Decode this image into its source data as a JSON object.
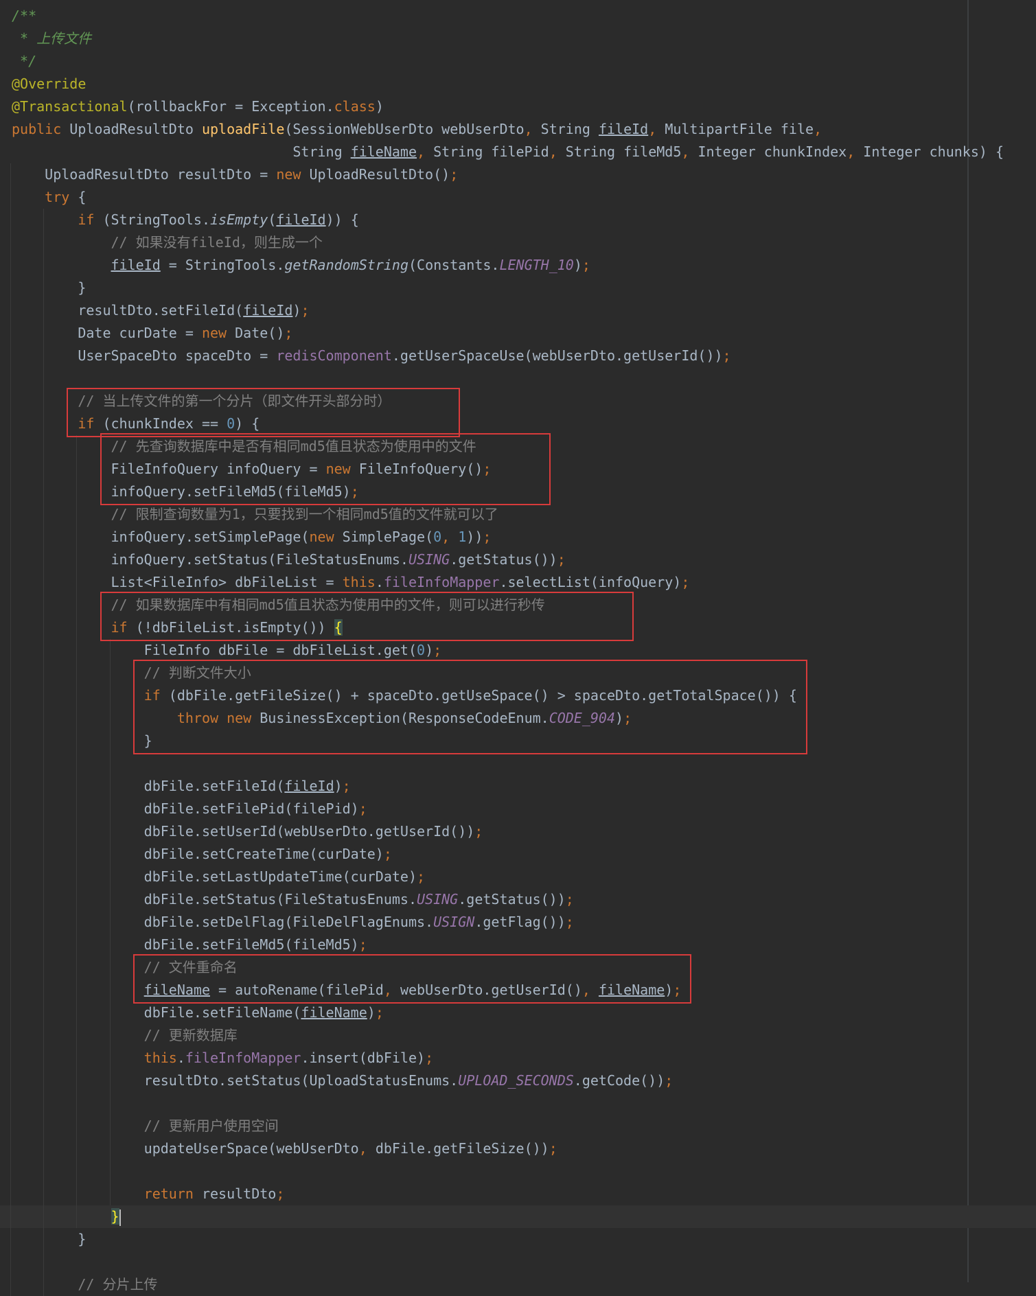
{
  "editor": {
    "lines": [
      [
        {
          "t": "/**",
          "c": "doc"
        }
      ],
      [
        {
          "t": " * ",
          "c": "doc"
        },
        {
          "t": "上传文件",
          "c": "doc"
        }
      ],
      [
        {
          "t": " */",
          "c": "doc"
        }
      ],
      [
        {
          "t": "@Override",
          "c": "an"
        }
      ],
      [
        {
          "t": "@Transactional",
          "c": "an"
        },
        {
          "t": "(rollbackFor = Exception."
        },
        {
          "t": "class",
          "c": "kw"
        },
        {
          "t": ")"
        }
      ],
      [
        {
          "t": "public ",
          "c": "kw"
        },
        {
          "t": "UploadResultDto "
        },
        {
          "t": "uploadFile",
          "c": "fn"
        },
        {
          "t": "(SessionWebUserDto webUserDto"
        },
        {
          "t": ", ",
          "c": "pn"
        },
        {
          "t": "String "
        },
        {
          "t": "fileId",
          "c": "ul"
        },
        {
          "t": ", ",
          "c": "pn"
        },
        {
          "t": "MultipartFile file"
        },
        {
          "t": ",",
          "c": "pn"
        }
      ],
      [
        {
          "t": "                                  String "
        },
        {
          "t": "fileName",
          "c": "ul"
        },
        {
          "t": ", ",
          "c": "pn"
        },
        {
          "t": "String filePid"
        },
        {
          "t": ", ",
          "c": "pn"
        },
        {
          "t": "String fileMd5"
        },
        {
          "t": ", ",
          "c": "pn"
        },
        {
          "t": "Integer chunkIndex"
        },
        {
          "t": ", ",
          "c": "pn"
        },
        {
          "t": "Integer chunks) {"
        }
      ],
      [
        {
          "t": "    UploadResultDto resultDto = "
        },
        {
          "t": "new ",
          "c": "kw"
        },
        {
          "t": "UploadResultDto()"
        },
        {
          "t": ";",
          "c": "pn"
        }
      ],
      [
        {
          "t": "    "
        },
        {
          "t": "try ",
          "c": "kw"
        },
        {
          "t": "{"
        }
      ],
      [
        {
          "t": "        "
        },
        {
          "t": "if ",
          "c": "kw"
        },
        {
          "t": "(StringTools."
        },
        {
          "t": "isEmpty",
          "c": "it"
        },
        {
          "t": "("
        },
        {
          "t": "fileId",
          "c": "ul"
        },
        {
          "t": ")) {"
        }
      ],
      [
        {
          "t": "            // 如果没有fileId，则生成一个",
          "c": "cm"
        }
      ],
      [
        {
          "t": "            "
        },
        {
          "t": "fileId",
          "c": "ul"
        },
        {
          "t": " = StringTools."
        },
        {
          "t": "getRandomString",
          "c": "it"
        },
        {
          "t": "(Constants."
        },
        {
          "t": "LENGTH_10",
          "c": "cst"
        },
        {
          "t": ")"
        },
        {
          "t": ";",
          "c": "pn"
        }
      ],
      [
        {
          "t": "        }"
        }
      ],
      [
        {
          "t": "        resultDto.setFileId("
        },
        {
          "t": "fileId",
          "c": "ul"
        },
        {
          "t": ")"
        },
        {
          "t": ";",
          "c": "pn"
        }
      ],
      [
        {
          "t": "        Date curDate = "
        },
        {
          "t": "new ",
          "c": "kw"
        },
        {
          "t": "Date()"
        },
        {
          "t": ";",
          "c": "pn"
        }
      ],
      [
        {
          "t": "        UserSpaceDto spaceDto = "
        },
        {
          "t": "redisComponent",
          "c": "fld"
        },
        {
          "t": ".getUserSpaceUse(webUserDto.getUserId())"
        },
        {
          "t": ";",
          "c": "pn"
        }
      ],
      [],
      [
        {
          "t": "        // 当上传文件的第一个分片（即文件开头部分时）",
          "c": "cm"
        }
      ],
      [
        {
          "t": "        "
        },
        {
          "t": "if ",
          "c": "kw"
        },
        {
          "t": "(chunkIndex == "
        },
        {
          "t": "0",
          "c": "num"
        },
        {
          "t": ") {"
        }
      ],
      [
        {
          "t": "            // 先查询数据库中是否有相同md5值且状态为使用中的文件",
          "c": "cm"
        }
      ],
      [
        {
          "t": "            FileInfoQuery infoQuery = "
        },
        {
          "t": "new ",
          "c": "kw"
        },
        {
          "t": "FileInfoQuery()"
        },
        {
          "t": ";",
          "c": "pn"
        }
      ],
      [
        {
          "t": "            infoQuery.setFileMd5(fileMd5)"
        },
        {
          "t": ";",
          "c": "pn"
        }
      ],
      [
        {
          "t": "            // 限制查询数量为1，只要找到一个相同md5值的文件就可以了",
          "c": "cm"
        }
      ],
      [
        {
          "t": "            infoQuery.setSimplePage("
        },
        {
          "t": "new ",
          "c": "kw"
        },
        {
          "t": "SimplePage("
        },
        {
          "t": "0",
          "c": "num"
        },
        {
          "t": ", ",
          "c": "pn"
        },
        {
          "t": "1",
          "c": "num"
        },
        {
          "t": "))"
        },
        {
          "t": ";",
          "c": "pn"
        }
      ],
      [
        {
          "t": "            infoQuery.setStatus(FileStatusEnums."
        },
        {
          "t": "USING",
          "c": "cst"
        },
        {
          "t": ".getStatus())"
        },
        {
          "t": ";",
          "c": "pn"
        }
      ],
      [
        {
          "t": "            List<FileInfo> dbFileList = "
        },
        {
          "t": "this",
          "c": "kw"
        },
        {
          "t": "."
        },
        {
          "t": "fileInfoMapper",
          "c": "fld"
        },
        {
          "t": ".selectList(infoQuery)"
        },
        {
          "t": ";",
          "c": "pn"
        }
      ],
      [
        {
          "t": "            // 如果数据库中有相同md5值且状态为使用中的文件，则可以进行秒传",
          "c": "cm"
        }
      ],
      [
        {
          "t": "            "
        },
        {
          "t": "if ",
          "c": "kw"
        },
        {
          "t": "(!dbFileList.isEmpty()) "
        },
        {
          "t": "{",
          "c": "brace-hl"
        }
      ],
      [
        {
          "t": "                FileInfo dbFile = dbFileList.get("
        },
        {
          "t": "0",
          "c": "num"
        },
        {
          "t": ")"
        },
        {
          "t": ";",
          "c": "pn"
        }
      ],
      [
        {
          "t": "                // 判断文件大小",
          "c": "cm"
        }
      ],
      [
        {
          "t": "                "
        },
        {
          "t": "if ",
          "c": "kw"
        },
        {
          "t": "(dbFile.getFileSize() + spaceDto.getUseSpace() > spaceDto.getTotalSpace()) {"
        }
      ],
      [
        {
          "t": "                    "
        },
        {
          "t": "throw new ",
          "c": "kw"
        },
        {
          "t": "BusinessException(ResponseCodeEnum."
        },
        {
          "t": "CODE_904",
          "c": "cst"
        },
        {
          "t": ")"
        },
        {
          "t": ";",
          "c": "pn"
        }
      ],
      [
        {
          "t": "                }"
        }
      ],
      [],
      [
        {
          "t": "                dbFile.setFileId("
        },
        {
          "t": "fileId",
          "c": "ul"
        },
        {
          "t": ")"
        },
        {
          "t": ";",
          "c": "pn"
        }
      ],
      [
        {
          "t": "                dbFile.setFilePid(filePid)"
        },
        {
          "t": ";",
          "c": "pn"
        }
      ],
      [
        {
          "t": "                dbFile.setUserId(webUserDto.getUserId())"
        },
        {
          "t": ";",
          "c": "pn"
        }
      ],
      [
        {
          "t": "                dbFile.setCreateTime(curDate)"
        },
        {
          "t": ";",
          "c": "pn"
        }
      ],
      [
        {
          "t": "                dbFile.setLastUpdateTime(curDate)"
        },
        {
          "t": ";",
          "c": "pn"
        }
      ],
      [
        {
          "t": "                dbFile.setStatus(FileStatusEnums."
        },
        {
          "t": "USING",
          "c": "cst"
        },
        {
          "t": ".getStatus())"
        },
        {
          "t": ";",
          "c": "pn"
        }
      ],
      [
        {
          "t": "                dbFile.setDelFlag(FileDelFlagEnums."
        },
        {
          "t": "USIGN",
          "c": "cst"
        },
        {
          "t": ".getFlag())"
        },
        {
          "t": ";",
          "c": "pn"
        }
      ],
      [
        {
          "t": "                dbFile.setFileMd5(fileMd5)"
        },
        {
          "t": ";",
          "c": "pn"
        }
      ],
      [
        {
          "t": "                // 文件重命名",
          "c": "cm"
        }
      ],
      [
        {
          "t": "                "
        },
        {
          "t": "fileName",
          "c": "ul"
        },
        {
          "t": " = autoRename(filePid"
        },
        {
          "t": ", ",
          "c": "pn"
        },
        {
          "t": "webUserDto.getUserId()"
        },
        {
          "t": ", ",
          "c": "pn"
        },
        {
          "t": "fileName",
          "c": "ul"
        },
        {
          "t": ")"
        },
        {
          "t": ";",
          "c": "pn"
        }
      ],
      [
        {
          "t": "                dbFile.setFileName("
        },
        {
          "t": "fileName",
          "c": "ul"
        },
        {
          "t": ")"
        },
        {
          "t": ";",
          "c": "pn"
        }
      ],
      [
        {
          "t": "                // 更新数据库",
          "c": "cm"
        }
      ],
      [
        {
          "t": "                "
        },
        {
          "t": "this",
          "c": "kw"
        },
        {
          "t": "."
        },
        {
          "t": "fileInfoMapper",
          "c": "fld"
        },
        {
          "t": ".insert(dbFile)"
        },
        {
          "t": ";",
          "c": "pn"
        }
      ],
      [
        {
          "t": "                resultDto.setStatus(UploadStatusEnums."
        },
        {
          "t": "UPLOAD_SECONDS",
          "c": "cst"
        },
        {
          "t": ".getCode())"
        },
        {
          "t": ";",
          "c": "pn"
        }
      ],
      [],
      [
        {
          "t": "                // 更新用户使用空间",
          "c": "cm"
        }
      ],
      [
        {
          "t": "                updateUserSpace(webUserDto"
        },
        {
          "t": ", ",
          "c": "pn"
        },
        {
          "t": "dbFile.getFileSize())"
        },
        {
          "t": ";",
          "c": "pn"
        }
      ],
      [],
      [
        {
          "t": "                "
        },
        {
          "t": "return ",
          "c": "kw"
        },
        {
          "t": "resultDto"
        },
        {
          "t": ";",
          "c": "pn"
        }
      ],
      [
        {
          "t": "            "
        },
        {
          "t": "}",
          "c": "brace-hl"
        },
        {
          "t": "",
          "c": "caret"
        }
      ],
      [
        {
          "t": "        }"
        }
      ],
      [],
      [
        {
          "t": "        // 分片上传",
          "c": "cm"
        }
      ]
    ],
    "current_line": 53,
    "highlight_boxes": [
      {
        "name": "first-chunk-comment-box",
        "from": 17,
        "to": 18
      },
      {
        "name": "md5-query-box",
        "from": 19,
        "to": 21
      },
      {
        "name": "instant-upload-box",
        "from": 26,
        "to": 27
      },
      {
        "name": "file-size-check-box",
        "from": 29,
        "to": 32
      },
      {
        "name": "file-rename-box",
        "from": 42,
        "to": 43
      }
    ],
    "colors": {
      "background": "#2b2b2b",
      "keyword": "#cc7832",
      "number": "#6897bb",
      "method": "#ffc66d",
      "annotation": "#bbb529",
      "comment": "#808080",
      "doc_comment": "#629755",
      "constant": "#9876aa",
      "text": "#a9b7c6",
      "highlight_box": "#d83b3b"
    }
  }
}
